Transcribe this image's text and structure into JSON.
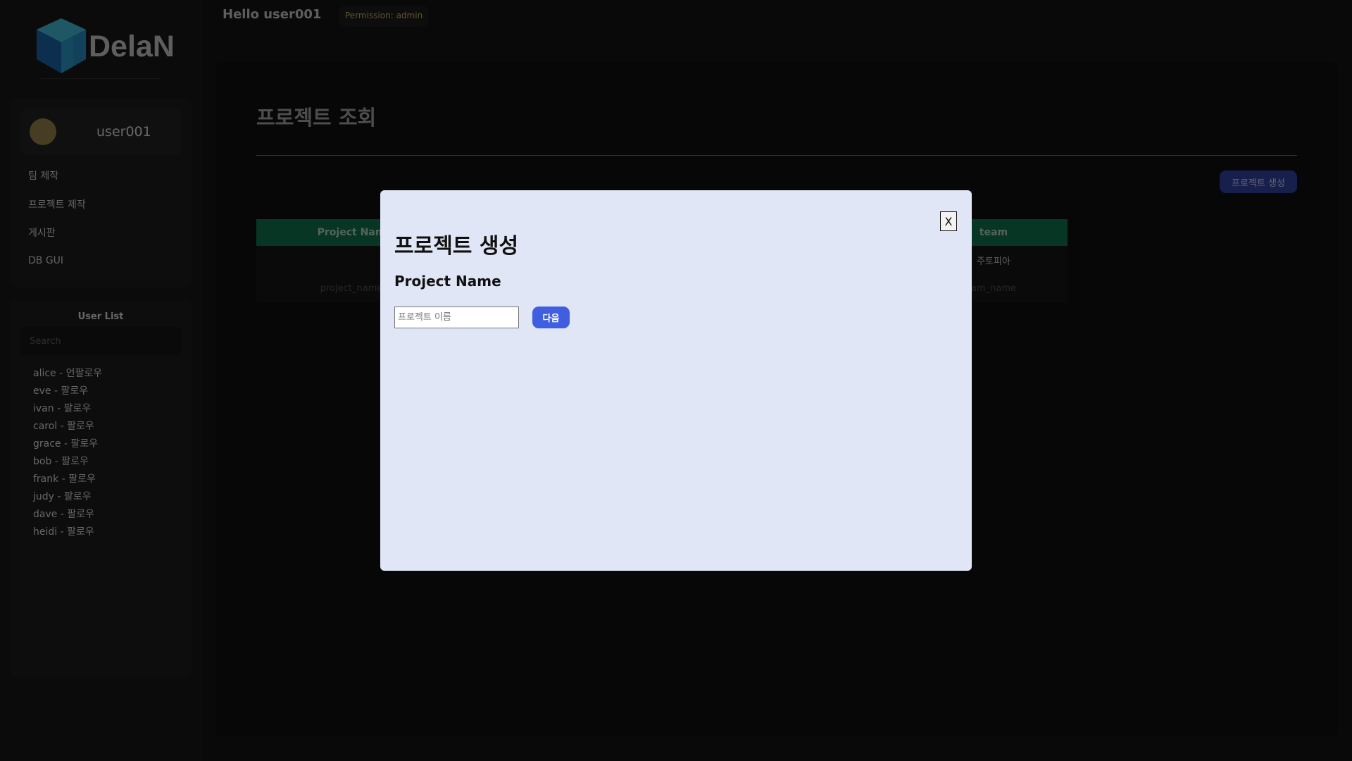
{
  "brand": {
    "name": "DelaN"
  },
  "header": {
    "greeting": "Hello user001",
    "permission": "Permission: admin"
  },
  "sidebar": {
    "profile_name": "user001",
    "nav_items": [
      {
        "label": "팀 제작"
      },
      {
        "label": "프로젝트 제작"
      },
      {
        "label": "게시판"
      },
      {
        "label": "DB GUI"
      }
    ],
    "user_list": {
      "title": "User List",
      "search_placeholder": "Search",
      "users": [
        "alice - 언팔로우",
        "eve - 팔로우",
        "ivan - 팔로우",
        "carol - 팔로우",
        "grace - 팔로우",
        "bob - 팔로우",
        "frank - 팔로우",
        "judy - 팔로우",
        "dave - 팔로우",
        "heidi - 팔로우"
      ]
    }
  },
  "main": {
    "title": "프로젝트 조회",
    "create_button": "프로젝트 생성",
    "table": {
      "headers": {
        "project_name": "Project Nam",
        "team": "team"
      },
      "rows": [
        {
          "project": "",
          "team": "주토피아"
        },
        {
          "project": "project_name",
          "team": "am_name"
        }
      ]
    }
  },
  "modal": {
    "close_label": "X",
    "title": "프로젝트 생성",
    "field_label": "Project Name",
    "input_placeholder": "프로젝트 이름",
    "next_button": "다음"
  },
  "colors": {
    "accent_blue": "#3f5ee0",
    "table_header_green": "#0e6e48",
    "modal_bg": "#e1e6f6",
    "permission_gold": "#c5a35e"
  }
}
